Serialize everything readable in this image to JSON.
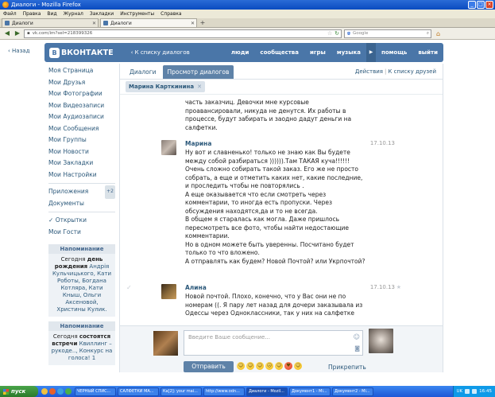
{
  "window": {
    "title": "Диалоги - Mozilla Firefox"
  },
  "menu": [
    "Файл",
    "Правка",
    "Вид",
    "Журнал",
    "Закладки",
    "Инструменты",
    "Справка"
  ],
  "tabs": [
    {
      "label": "Диалоги"
    },
    {
      "label": "Диалоги"
    }
  ],
  "address": {
    "url": "vk.com/im?sel=218399326"
  },
  "search": {
    "placeholder": "Google"
  },
  "vk": {
    "back_label": "Назад",
    "logo_text": "ВКОНТАКТЕ",
    "logo_letter": "В",
    "header_back": "К списку диалогов",
    "top_menu": [
      "люди",
      "сообщества",
      "игры",
      "музыка",
      "помощь",
      "выйти"
    ],
    "left_menu": [
      "Моя Страница",
      "Мои Друзья",
      "Мои Фотографии",
      "Мои Видеозаписи",
      "Мои Аудиозаписи",
      "Мои Сообщения",
      "Мои Группы",
      "Мои Новости",
      "Мои Закладки",
      "Мои Настройки"
    ],
    "apps_label": "Приложения",
    "apps_badge": "+2",
    "docs_label": "Документы",
    "openings_label": "Открытки",
    "guests_label": "Мои Гости",
    "reminders": [
      {
        "title": "Напоминание",
        "pre": "Сегодня",
        "bold": "день рождения",
        "names": "Андрія Кульчицького, Кати Роботы, Богдана Котляра, Кати Кныш, Ольги Аксеновой, Христины Кулик."
      },
      {
        "title": "Напоминание",
        "pre": "Сегодня",
        "bold": "состоятся встречи",
        "names": "Квиллинг – рукоде.., Конкурс на",
        "extra": "голоса! 1"
      }
    ],
    "tabs": {
      "dialogs": "Диалоги",
      "view": "Просмотр диалогов",
      "actions": "Действия",
      "friends": "К списку друзей"
    },
    "chip": "Марина Карткинина",
    "messages": [
      {
        "name": "",
        "date": "",
        "lines": [
          "часть заказчиц. Девочки мне курсовые",
          "проавансировали, никуда не денутся. Их работы в",
          "процессе, будут забирать и заодно дадут деньги на",
          "салфетки."
        ]
      },
      {
        "name": "Марина",
        "date": "17.10.13",
        "lines": [
          "Ну вот и славненько! только не знаю как Вы будете",
          "между собой разбираться )))))).Там ТАКАЯ куча!!!!!!",
          "Очень сложно собирать такой заказ. Его же не просто",
          "собрать, а еще и отметить каких нет, какие последние,",
          "и проследить чтобы не повторялись .",
          "А еще оказывается что если смотреть через",
          "комментарии, то иногда есть пропуски. Через",
          "обсуждения находятся,да и то не всегда.",
          "В общем я старалась как могла. Даже пришлось",
          "пересмотреть все фото, чтобы найти недостающие",
          "комментарии.",
          "Но в одном можете быть уверенны. Посчитано будет",
          "только то что вложено.",
          "А отправлять как будем? Новой Почтой? или Укрпочтой?"
        ]
      },
      {
        "name": "Алина",
        "date": "17.10.13",
        "lines": [
          "Новой почтой. Плохо, конечно, что у Вас они не по",
          "номерам ((. Я пару лет назад для дочери заказывала из",
          "Одессы через Одноклассники, так у них на салфетке"
        ]
      }
    ],
    "composer": {
      "placeholder": "Введите Ваше сообщение...",
      "send": "Отправить",
      "attach": "Прикрепить"
    }
  },
  "taskbar": {
    "start": "пуск",
    "items": [
      "ЧЕРНЫЙ СПИС...",
      "САЛФЕТКИ МА...",
      "Ка[2]: your mai...",
      "http://www.odn...",
      "Диалоги - Mozil...",
      "Документ1 - Mi...",
      "Документ2 - Mi..."
    ],
    "lang": "UK",
    "clock": "16:45"
  },
  "colors": {
    "vk_blue": "#4a76a8",
    "link": "#2b587a"
  }
}
